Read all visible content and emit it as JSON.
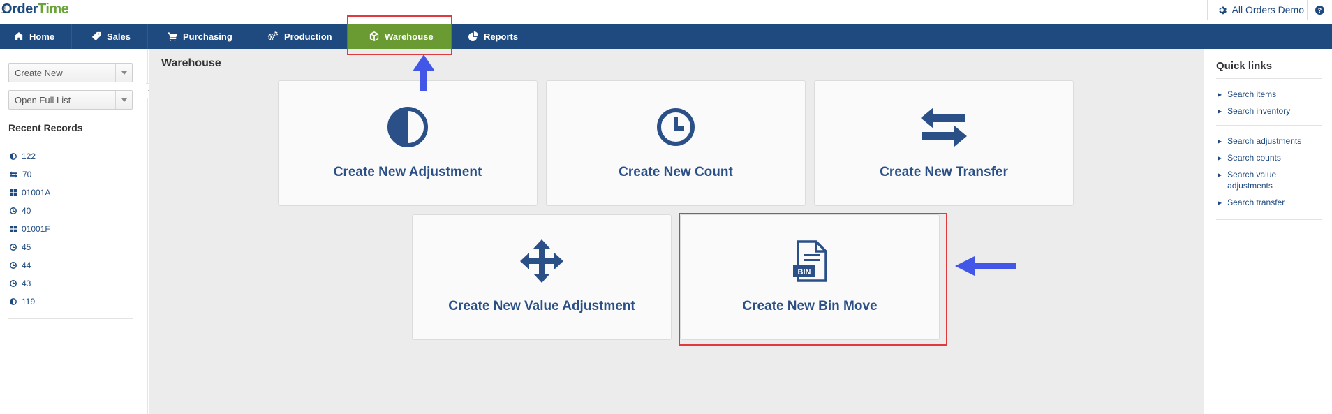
{
  "brand": {
    "logo_o": "O",
    "logo_rder": "rder",
    "logo_time": "Time"
  },
  "header": {
    "account_label": "All Orders Demo"
  },
  "nav": {
    "items": [
      {
        "label": "Home",
        "icon": "home-icon"
      },
      {
        "label": "Sales",
        "icon": "tag-icon"
      },
      {
        "label": "Purchasing",
        "icon": "cart-icon"
      },
      {
        "label": "Production",
        "icon": "gears-icon"
      },
      {
        "label": "Warehouse",
        "icon": "cube-icon",
        "active": true
      },
      {
        "label": "Reports",
        "icon": "pie-chart-icon"
      }
    ]
  },
  "sidebar": {
    "create_new": "Create New",
    "open_full_list": "Open Full List",
    "recent_title": "Recent Records",
    "recent": [
      {
        "label": "122",
        "icon": "half-circle-icon"
      },
      {
        "label": "70",
        "icon": "transfer-icon"
      },
      {
        "label": "01001A",
        "icon": "grid-icon"
      },
      {
        "label": "40",
        "icon": "clock-icon"
      },
      {
        "label": "01001F",
        "icon": "grid-icon"
      },
      {
        "label": "45",
        "icon": "clock-icon"
      },
      {
        "label": "44",
        "icon": "clock-icon"
      },
      {
        "label": "43",
        "icon": "clock-icon"
      },
      {
        "label": "119",
        "icon": "half-circle-icon"
      }
    ]
  },
  "main": {
    "title": "Warehouse",
    "tiles": [
      {
        "label": "Create New Adjustment",
        "icon": "half-circle-icon"
      },
      {
        "label": "Create New Count",
        "icon": "clock-icon"
      },
      {
        "label": "Create New Transfer",
        "icon": "transfer-arrows-icon"
      },
      {
        "label": "Create New Value Adjustment",
        "icon": "move-arrows-icon"
      },
      {
        "label": "Create New Bin Move",
        "icon": "bin-document-icon",
        "icon_text": "BIN"
      }
    ]
  },
  "quick_links": {
    "title": "Quick links",
    "items": [
      "Search items",
      "Search inventory",
      "Search adjustments",
      "Search counts",
      "Search value adjustments",
      "Search transfer"
    ]
  },
  "colors": {
    "nav_bg": "#1e4a80",
    "nav_active": "#6a9b32",
    "highlight": "#e0393e",
    "annotation_arrow": "#4257e8",
    "tile_text": "#2b5087"
  }
}
